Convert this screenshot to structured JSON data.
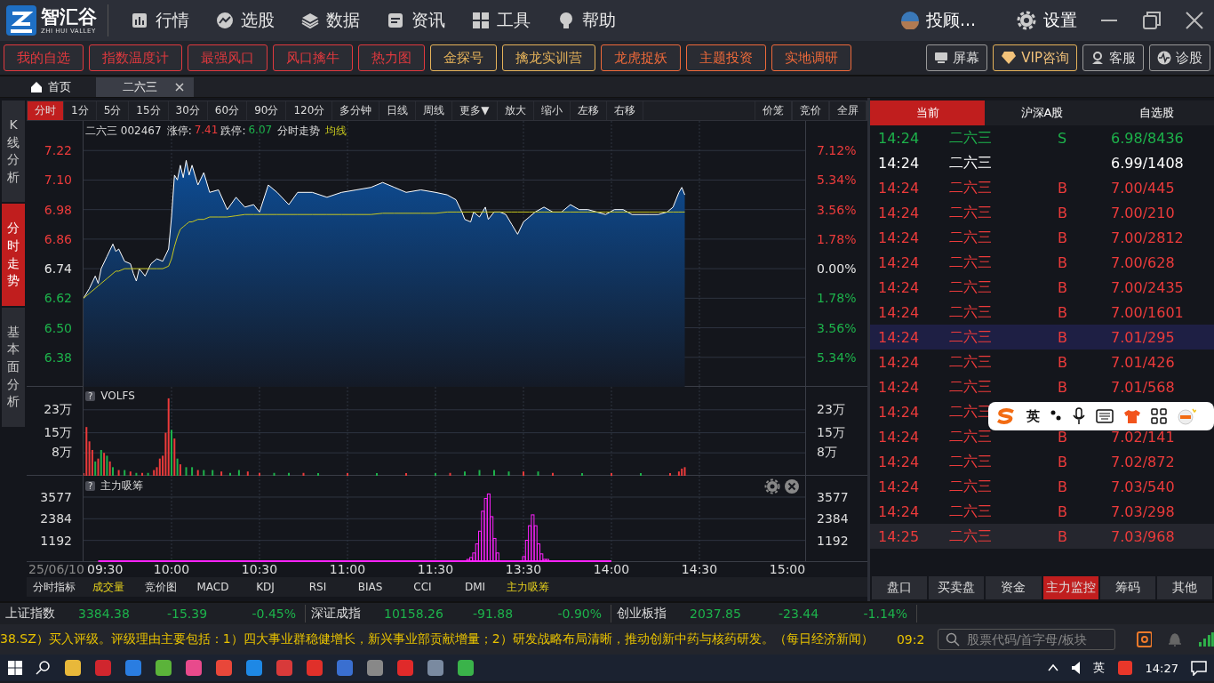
{
  "app": {
    "logo": "智汇谷",
    "logo_sub": "ZHI HUI VALLEY",
    "nav": [
      "行情",
      "选股",
      "数据",
      "资讯",
      "工具",
      "帮助"
    ],
    "user": "投顾...",
    "settings": "设置"
  },
  "quick_buttons": [
    {
      "label": "我的自选",
      "color": "#e0393e"
    },
    {
      "label": "指数温度计",
      "color": "#e0393e"
    },
    {
      "label": "最强风口",
      "color": "#e0393e"
    },
    {
      "label": "风口擒牛",
      "color": "#e0393e"
    },
    {
      "label": "热力图",
      "color": "#e0393e"
    },
    {
      "label": "金探号",
      "color": "#e6b35a"
    },
    {
      "label": "擒龙实训营",
      "color": "#e6b35a"
    },
    {
      "label": "龙虎捉妖",
      "color": "#f06a3a"
    },
    {
      "label": "主题投资",
      "color": "#f06a3a"
    },
    {
      "label": "实地调研",
      "color": "#f06a3a"
    }
  ],
  "tool_buttons": [
    {
      "label": "屏幕",
      "kind": "screen"
    },
    {
      "label": "VIP咨询",
      "kind": "vip"
    },
    {
      "label": "客服",
      "kind": "service"
    },
    {
      "label": "诊股",
      "kind": "diagnose"
    }
  ],
  "doc_tabs": [
    {
      "label": "首页",
      "kind": "home",
      "selected": false
    },
    {
      "label": "二六三",
      "kind": "stock",
      "selected": true
    }
  ],
  "periods": [
    {
      "label": "分时",
      "selected": true
    },
    {
      "label": "1分",
      "selected": false
    },
    {
      "label": "5分",
      "selected": false
    },
    {
      "label": "15分",
      "selected": false
    },
    {
      "label": "30分",
      "selected": false
    },
    {
      "label": "60分",
      "selected": false
    },
    {
      "label": "90分",
      "selected": false
    },
    {
      "label": "120分",
      "selected": false
    },
    {
      "label": "多分钟",
      "selected": false
    },
    {
      "label": "日线",
      "selected": false
    },
    {
      "label": "周线",
      "selected": false
    },
    {
      "label": "更多▼",
      "selected": false
    },
    {
      "label": "放大",
      "selected": false
    },
    {
      "label": "缩小",
      "selected": false
    },
    {
      "label": "左移",
      "selected": false
    },
    {
      "label": "右移",
      "selected": false
    }
  ],
  "period_right": [
    "价笼",
    "竞价",
    "全屏"
  ],
  "side_tabs": [
    {
      "label": "K线分析",
      "selected": false
    },
    {
      "label": "分时走势",
      "selected": true
    },
    {
      "label": "基本面分析",
      "selected": false
    }
  ],
  "chart_header": {
    "stock": "二六三 002467",
    "limit_up_label": "涨停:",
    "limit_up": "7.41",
    "limit_down_label": "跌停:",
    "limit_down": "6.07",
    "mode": "分时走势",
    "avg": "均线"
  },
  "price_panel": {
    "left_labels": [
      {
        "label": "7.22",
        "color": "#ec3b3b"
      },
      {
        "label": "7.10",
        "color": "#ec3b3b"
      },
      {
        "label": "6.98",
        "color": "#ec3b3b"
      },
      {
        "label": "6.86",
        "color": "#ec3b3b"
      },
      {
        "label": "6.74",
        "color": "#e6e6e6"
      },
      {
        "label": "6.62",
        "color": "#1db24b"
      },
      {
        "label": "6.50",
        "color": "#1db24b"
      },
      {
        "label": "6.38",
        "color": "#1db24b"
      }
    ],
    "right_labels": [
      {
        "label": "7.12%",
        "color": "#ec3b3b"
      },
      {
        "label": "5.34%",
        "color": "#ec3b3b"
      },
      {
        "label": "3.56%",
        "color": "#ec3b3b"
      },
      {
        "label": "1.78%",
        "color": "#ec3b3b"
      },
      {
        "label": "0.00%",
        "color": "#e6e6e6"
      },
      {
        "label": "1.78%",
        "color": "#1db24b"
      },
      {
        "label": "3.56%",
        "color": "#1db24b"
      },
      {
        "label": "5.34%",
        "color": "#1db24b"
      }
    ]
  },
  "volume_panel": {
    "help": "?",
    "title": "VOLFS",
    "left_labels": [
      "23万",
      "15万",
      "8万"
    ],
    "right_labels": [
      "23万",
      "15万",
      "8万"
    ]
  },
  "flow_panel": {
    "help": "?",
    "title": "主力吸筹",
    "left_labels": [
      "3577",
      "2384",
      "1192"
    ],
    "right_labels": [
      "3577",
      "2384",
      "1192"
    ]
  },
  "time_axis": {
    "date": "25/06/10",
    "labels": [
      "09:30",
      "10:00",
      "10:30",
      "11:00",
      "11:30",
      "13:30",
      "14:00",
      "14:30",
      "15:00"
    ]
  },
  "indicator_label": "分时指标",
  "indicator_tabs": [
    {
      "label": "成交量",
      "selected": true
    },
    {
      "label": "竞价图",
      "selected": false
    },
    {
      "label": "MACD",
      "selected": false
    },
    {
      "label": "KDJ",
      "selected": false
    },
    {
      "label": "RSI",
      "selected": false
    },
    {
      "label": "BIAS",
      "selected": false
    },
    {
      "label": "CCI",
      "selected": false
    },
    {
      "label": "DMI",
      "selected": false
    },
    {
      "label": "主力吸筹",
      "selected": true
    }
  ],
  "ticks": {
    "tabs": [
      {
        "label": "当前",
        "selected": true
      },
      {
        "label": "沪深A股",
        "selected": false
      },
      {
        "label": "自选股",
        "selected": false
      }
    ],
    "rows": [
      {
        "time": "14:24",
        "name": "二六三",
        "side": "S",
        "price": "6.98/8436",
        "kind": "sell",
        "selected": false,
        "hovered": false
      },
      {
        "time": "14:24",
        "name": "二六三",
        "price": "6.99/1408",
        "kind": "neutral",
        "selected": false,
        "hovered": false
      },
      {
        "time": "14:24",
        "name": "二六三",
        "side": "B",
        "price": "7.00/445",
        "kind": "buy",
        "selected": false,
        "hovered": false
      },
      {
        "time": "14:24",
        "name": "二六三",
        "side": "B",
        "price": "7.00/210",
        "kind": "buy",
        "selected": false,
        "hovered": false
      },
      {
        "time": "14:24",
        "name": "二六三",
        "side": "B",
        "price": "7.00/2812",
        "kind": "buy",
        "selected": false,
        "hovered": false
      },
      {
        "time": "14:24",
        "name": "二六三",
        "side": "B",
        "price": "7.00/628",
        "kind": "buy",
        "selected": false,
        "hovered": false
      },
      {
        "time": "14:24",
        "name": "二六三",
        "side": "B",
        "price": "7.00/2435",
        "kind": "buy",
        "selected": false,
        "hovered": false
      },
      {
        "time": "14:24",
        "name": "二六三",
        "side": "B",
        "price": "7.00/1601",
        "kind": "buy",
        "selected": false,
        "hovered": false
      },
      {
        "time": "14:24",
        "name": "二六三",
        "side": "B",
        "price": "7.01/295",
        "kind": "buy",
        "selected": true,
        "hovered": false
      },
      {
        "time": "14:24",
        "name": "二六三",
        "side": "B",
        "price": "7.01/426",
        "kind": "buy",
        "selected": false,
        "hovered": false
      },
      {
        "time": "14:24",
        "name": "二六三",
        "side": "B",
        "price": "7.01/568",
        "kind": "buy",
        "selected": false,
        "hovered": false
      },
      {
        "time": "14:24",
        "name": "二六三",
        "kind": "buy",
        "selected": false,
        "hovered": false
      },
      {
        "time": "14:24",
        "name": "二六三",
        "side": "B",
        "price": "7.02/141",
        "kind": "buy",
        "selected": false,
        "hovered": false
      },
      {
        "time": "14:24",
        "name": "二六三",
        "side": "B",
        "price": "7.02/872",
        "kind": "buy",
        "selected": false,
        "hovered": false
      },
      {
        "time": "14:24",
        "name": "二六三",
        "side": "B",
        "price": "7.03/540",
        "kind": "buy",
        "selected": false,
        "hovered": false
      },
      {
        "time": "14:24",
        "name": "二六三",
        "side": "B",
        "price": "7.03/298",
        "kind": "buy",
        "selected": false,
        "hovered": false
      },
      {
        "time": "14:25",
        "name": "二六三",
        "side": "B",
        "price": "7.03/968",
        "kind": "buy",
        "selected": false,
        "hovered": true
      }
    ],
    "bottom_tabs": [
      {
        "label": "盘口",
        "selected": false
      },
      {
        "label": "买卖盘",
        "selected": false
      },
      {
        "label": "资金",
        "selected": false
      },
      {
        "label": "主力监控",
        "selected": true
      },
      {
        "label": "筹码",
        "selected": false
      },
      {
        "label": "其他",
        "selected": false
      }
    ]
  },
  "ime": {
    "mode": "英"
  },
  "indices": [
    {
      "name": "上证指数",
      "value": "3384.38",
      "change": "-15.39",
      "pct": "-0.45%",
      "color": "#1db24b"
    },
    {
      "name": "深证成指",
      "value": "10158.26",
      "change": "-91.88",
      "pct": "-0.90%",
      "color": "#1db24b"
    },
    {
      "name": "创业板指",
      "value": "2037.85",
      "change": "-23.44",
      "pct": "-1.14%",
      "color": "#1db24b"
    }
  ],
  "news": {
    "text": "38.SZ）买入评级。评级理由主要包括：1）四大事业群稳健增长，新兴事业部贡献增量；2）研发战略布局清晰，推动创新中药与核药研发。（每日经济新闻）",
    "time": "09:2"
  },
  "search": {
    "placeholder": "股票代码/首字母/板块"
  },
  "taskbar": {
    "ime": "英",
    "clock": "14:27"
  }
}
